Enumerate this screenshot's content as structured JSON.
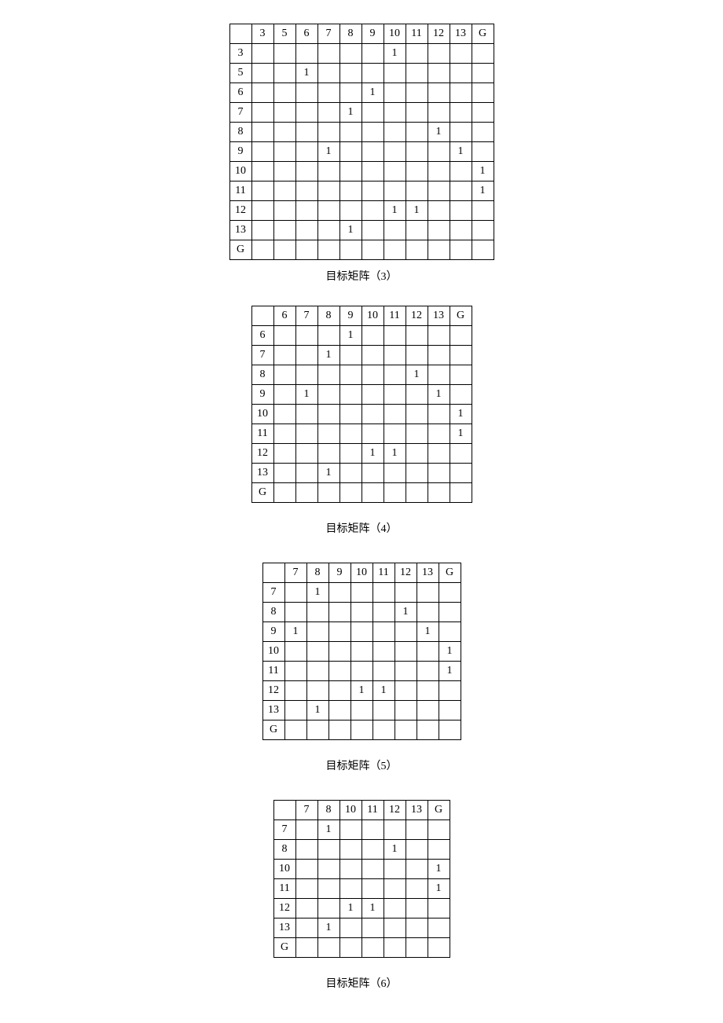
{
  "matrices": [
    {
      "id": 3,
      "caption": "目标矩阵（3）",
      "headers": [
        "3",
        "5",
        "6",
        "7",
        "8",
        "9",
        "10",
        "11",
        "12",
        "13",
        "G"
      ],
      "rows": [
        {
          "label": "3",
          "cells": [
            "",
            "",
            "",
            "",
            "",
            "",
            "1",
            "",
            "",
            "",
            ""
          ]
        },
        {
          "label": "5",
          "cells": [
            "",
            "",
            "1",
            "",
            "",
            "",
            "",
            "",
            "",
            "",
            ""
          ]
        },
        {
          "label": "6",
          "cells": [
            "",
            "",
            "",
            "",
            "",
            "1",
            "",
            "",
            "",
            "",
            ""
          ]
        },
        {
          "label": "7",
          "cells": [
            "",
            "",
            "",
            "",
            "1",
            "",
            "",
            "",
            "",
            "",
            ""
          ]
        },
        {
          "label": "8",
          "cells": [
            "",
            "",
            "",
            "",
            "",
            "",
            "",
            "",
            "1",
            "",
            ""
          ]
        },
        {
          "label": "9",
          "cells": [
            "",
            "",
            "",
            "1",
            "",
            "",
            "",
            "",
            "",
            "1",
            ""
          ]
        },
        {
          "label": "10",
          "cells": [
            "",
            "",
            "",
            "",
            "",
            "",
            "",
            "",
            "",
            "",
            "1"
          ]
        },
        {
          "label": "11",
          "cells": [
            "",
            "",
            "",
            "",
            "",
            "",
            "",
            "",
            "",
            "",
            "1"
          ]
        },
        {
          "label": "12",
          "cells": [
            "",
            "",
            "",
            "",
            "",
            "",
            "1",
            "1",
            "",
            "",
            ""
          ]
        },
        {
          "label": "13",
          "cells": [
            "",
            "",
            "",
            "",
            "1",
            "",
            "",
            "",
            "",
            "",
            ""
          ]
        },
        {
          "label": "G",
          "cells": [
            "",
            "",
            "",
            "",
            "",
            "",
            "",
            "",
            "",
            "",
            ""
          ]
        }
      ]
    },
    {
      "id": 4,
      "caption": "目标矩阵（4）",
      "headers": [
        "6",
        "7",
        "8",
        "9",
        "10",
        "11",
        "12",
        "13",
        "G"
      ],
      "rows": [
        {
          "label": "6",
          "cells": [
            "",
            "",
            "",
            "1",
            "",
            "",
            "",
            "",
            ""
          ]
        },
        {
          "label": "7",
          "cells": [
            "",
            "",
            "1",
            "",
            "",
            "",
            "",
            "",
            ""
          ]
        },
        {
          "label": "8",
          "cells": [
            "",
            "",
            "",
            "",
            "",
            "",
            "1",
            "",
            ""
          ]
        },
        {
          "label": "9",
          "cells": [
            "",
            "1",
            "",
            "",
            "",
            "",
            "",
            "1",
            ""
          ]
        },
        {
          "label": "10",
          "cells": [
            "",
            "",
            "",
            "",
            "",
            "",
            "",
            "",
            "1"
          ]
        },
        {
          "label": "11",
          "cells": [
            "",
            "",
            "",
            "",
            "",
            "",
            "",
            "",
            "1"
          ]
        },
        {
          "label": "12",
          "cells": [
            "",
            "",
            "",
            "",
            "1",
            "1",
            "",
            "",
            ""
          ]
        },
        {
          "label": "13",
          "cells": [
            "",
            "",
            "1",
            "",
            "",
            "",
            "",
            "",
            ""
          ]
        },
        {
          "label": "G",
          "cells": [
            "",
            "",
            "",
            "",
            "",
            "",
            "",
            "",
            ""
          ]
        }
      ]
    },
    {
      "id": 5,
      "caption": "目标矩阵（5）",
      "headers": [
        "7",
        "8",
        "9",
        "10",
        "11",
        "12",
        "13",
        "G"
      ],
      "rows": [
        {
          "label": "7",
          "cells": [
            "",
            "1",
            "",
            "",
            "",
            "",
            "",
            ""
          ]
        },
        {
          "label": "8",
          "cells": [
            "",
            "",
            "",
            "",
            "",
            "1",
            "",
            ""
          ]
        },
        {
          "label": "9",
          "cells": [
            "1",
            "",
            "",
            "",
            "",
            "",
            "1",
            ""
          ]
        },
        {
          "label": "10",
          "cells": [
            "",
            "",
            "",
            "",
            "",
            "",
            "",
            "1"
          ]
        },
        {
          "label": "11",
          "cells": [
            "",
            "",
            "",
            "",
            "",
            "",
            "",
            "1"
          ]
        },
        {
          "label": "12",
          "cells": [
            "",
            "",
            "",
            "1",
            "1",
            "",
            "",
            ""
          ]
        },
        {
          "label": "13",
          "cells": [
            "",
            "1",
            "",
            "",
            "",
            "",
            "",
            ""
          ]
        },
        {
          "label": "G",
          "cells": [
            "",
            "",
            "",
            "",
            "",
            "",
            "",
            ""
          ]
        }
      ]
    },
    {
      "id": 6,
      "caption": "目标矩阵（6）",
      "headers": [
        "7",
        "8",
        "10",
        "11",
        "12",
        "13",
        "G"
      ],
      "rows": [
        {
          "label": "7",
          "cells": [
            "",
            "1",
            "",
            "",
            "",
            "",
            ""
          ]
        },
        {
          "label": "8",
          "cells": [
            "",
            "",
            "",
            "",
            "1",
            "",
            ""
          ]
        },
        {
          "label": "10",
          "cells": [
            "",
            "",
            "",
            "",
            "",
            "",
            "1"
          ]
        },
        {
          "label": "11",
          "cells": [
            "",
            "",
            "",
            "",
            "",
            "",
            "1"
          ]
        },
        {
          "label": "12",
          "cells": [
            "",
            "",
            "1",
            "1",
            "",
            "",
            ""
          ]
        },
        {
          "label": "13",
          "cells": [
            "",
            "1",
            "",
            "",
            "",
            "",
            ""
          ]
        },
        {
          "label": "G",
          "cells": [
            "",
            "",
            "",
            "",
            "",
            "",
            ""
          ]
        }
      ]
    }
  ]
}
